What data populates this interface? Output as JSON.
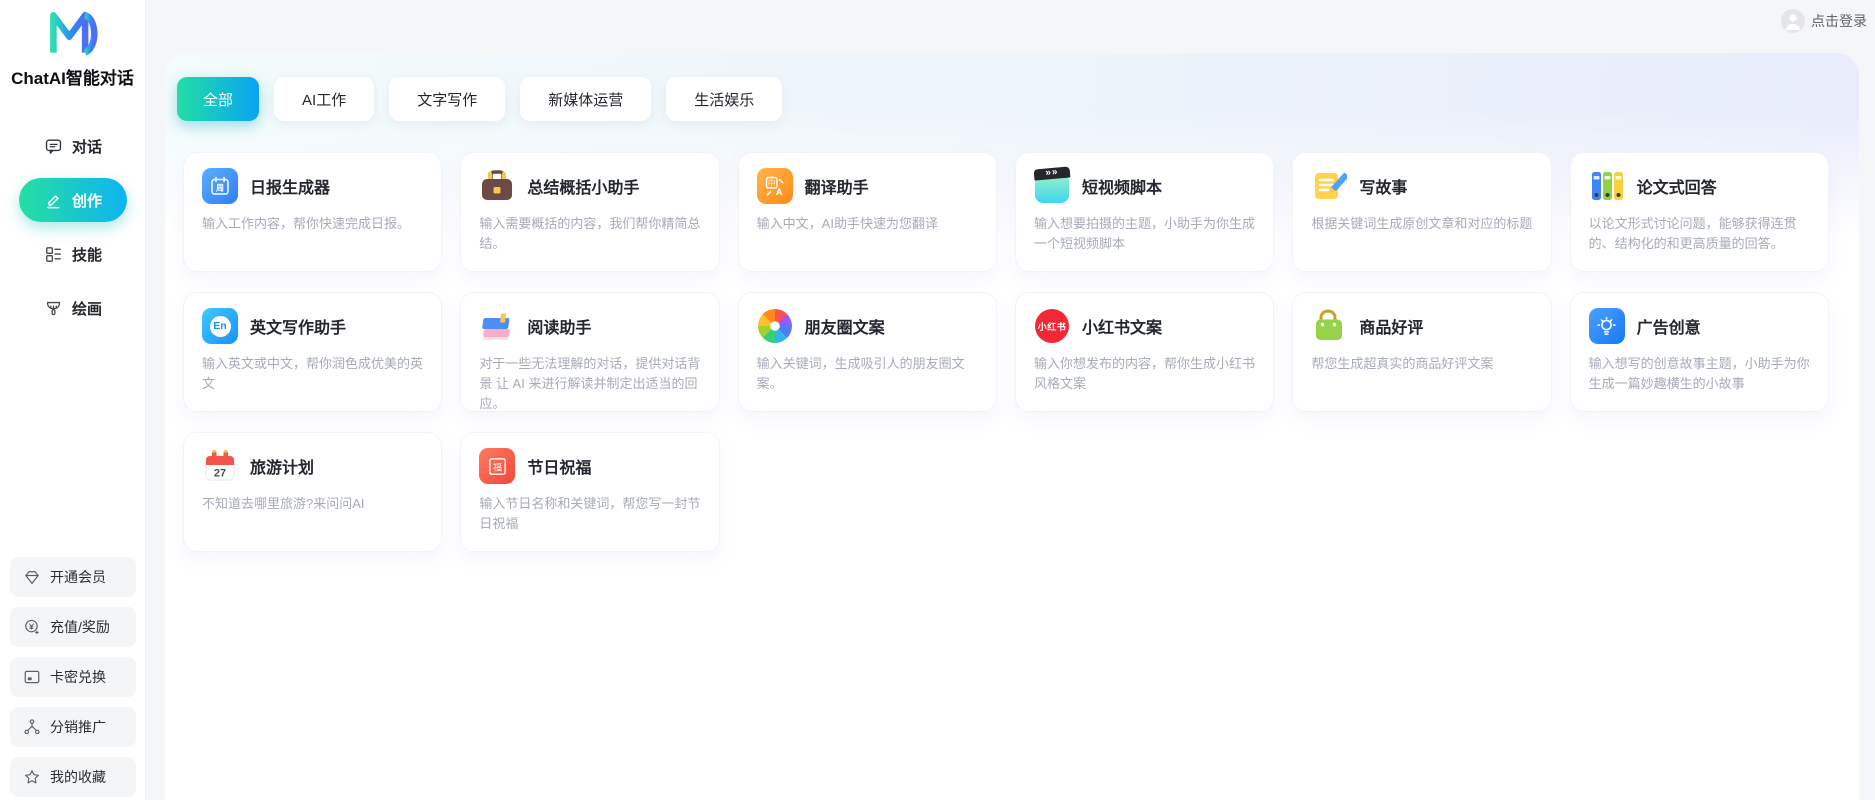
{
  "app": {
    "title": "ChatAI智能对话"
  },
  "header": {
    "login_label": "点击登录",
    "avatar_icon": "user-avatar-icon"
  },
  "colors": {
    "accent_gradient_start": "#25dfa2",
    "accent_gradient_end": "#0fb3f0",
    "page_background": "#f5f6f7",
    "panel_background": "#ffffff",
    "card_title": "#23262e",
    "card_desc": "#a6abb7"
  },
  "sidebar": {
    "nav": [
      {
        "name": "chat",
        "label": "对话",
        "icon": "chat-bubble-icon",
        "active": false
      },
      {
        "name": "creation",
        "label": "创作",
        "icon": "pencil-icon",
        "active": true
      },
      {
        "name": "skills",
        "label": "技能",
        "icon": "grid-icon",
        "active": false
      },
      {
        "name": "painting",
        "label": "绘画",
        "icon": "brush-icon",
        "active": false
      }
    ],
    "utilities": [
      {
        "name": "membership",
        "label": "开通会员",
        "icon": "gem-icon"
      },
      {
        "name": "recharge",
        "label": "充值/奖励",
        "icon": "coin-icon"
      },
      {
        "name": "card-redeem",
        "label": "卡密兑换",
        "icon": "card-icon"
      },
      {
        "name": "affiliate",
        "label": "分销推广",
        "icon": "share-network-icon"
      },
      {
        "name": "favorites",
        "label": "我的收藏",
        "icon": "star-icon"
      }
    ]
  },
  "tabs": [
    {
      "name": "all",
      "label": "全部",
      "active": true
    },
    {
      "name": "ai-work",
      "label": "AI工作",
      "active": false
    },
    {
      "name": "text-writing",
      "label": "文字写作",
      "active": false
    },
    {
      "name": "new-media",
      "label": "新媒体运营",
      "active": false
    },
    {
      "name": "life-fun",
      "label": "生活娱乐",
      "active": false
    }
  ],
  "cards": [
    {
      "name": "daily-report",
      "title": "日报生成器",
      "desc": "输入工作内容，帮你快速完成日报。",
      "icon": "daily-report-icon"
    },
    {
      "name": "summary",
      "title": "总结概括小助手",
      "desc": "输入需要概括的内容，我们帮你精简总结。",
      "icon": "briefcase-icon"
    },
    {
      "name": "translate",
      "title": "翻译助手",
      "desc": "输入中文，AI助手快速为您翻译",
      "icon": "translate-icon"
    },
    {
      "name": "short-video",
      "title": "短视频脚本",
      "desc": "输入想要拍摄的主题，小助手为你生成一个短视频脚本",
      "icon": "clapperboard-icon"
    },
    {
      "name": "story",
      "title": "写故事",
      "desc": "根据关键词生成原创文章和对应的标题",
      "icon": "notepad-pencil-icon"
    },
    {
      "name": "thesis-answer",
      "title": "论文式回答",
      "desc": "以论文形式讨论问题，能够获得连贯的、结构化的和更高质量的回答。",
      "icon": "binders-icon"
    },
    {
      "name": "english-writing",
      "title": "英文写作助手",
      "desc": "输入英文或中文，帮你润色成优美的英文",
      "icon": "english-icon"
    },
    {
      "name": "reading",
      "title": "阅读助手",
      "desc": "对于一些无法理解的对话，提供对话背景 让 AI 来进行解读并制定出适当的回应。",
      "icon": "books-icon"
    },
    {
      "name": "moments-copy",
      "title": "朋友圈文案",
      "desc": "输入关键词，生成吸引人的朋友圈文案。",
      "icon": "moments-icon"
    },
    {
      "name": "xiaohongshu-copy",
      "title": "小红书文案",
      "desc": "输入你想发布的内容，帮你生成小红书风格文案",
      "icon": "xiaohongshu-icon"
    },
    {
      "name": "product-review",
      "title": "商品好评",
      "desc": "帮您生成超真实的商品好评文案",
      "icon": "shopping-bag-icon"
    },
    {
      "name": "ad-creative",
      "title": "广告创意",
      "desc": "输入想写的创意故事主题，小助手为你生成一篇妙趣横生的小故事",
      "icon": "lightbulb-icon"
    },
    {
      "name": "travel-plan",
      "title": "旅游计划",
      "desc": "不知道去哪里旅游?来问问AI",
      "icon": "calendar-27-icon"
    },
    {
      "name": "festival-wishes",
      "title": "节日祝福",
      "desc": "输入节日名称和关键词，帮您写一封节日祝福",
      "icon": "fu-icon"
    }
  ],
  "icon_glyphs": {
    "daily-report-icon": "周",
    "translate-icon": "中",
    "translate-icon-letter": "A",
    "english-icon": "En",
    "clapperboard-icon": "»»",
    "xiaohongshu-icon": "小红书",
    "calendar-27-icon": "27",
    "fu-icon": "福"
  }
}
